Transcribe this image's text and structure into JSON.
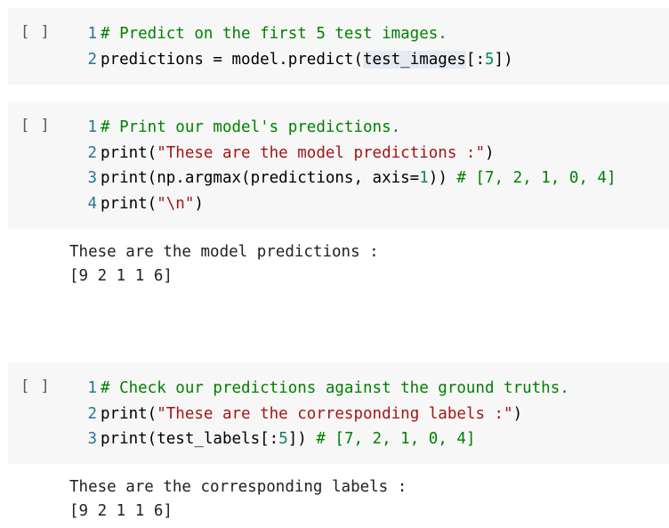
{
  "cells": [
    {
      "run_label": "[ ]",
      "lines": [
        {
          "num": "1",
          "tokens": [
            {
              "t": "# Predict on the first 5 test images.",
              "c": "c-com"
            }
          ]
        },
        {
          "num": "2",
          "tokens": [
            {
              "t": "predictions = model.predict(",
              "c": "c-txt"
            },
            {
              "t": "test_images",
              "c": "c-txt c-hl"
            },
            {
              "t": "[:",
              "c": "c-txt"
            },
            {
              "t": "5",
              "c": "c-num"
            },
            {
              "t": "])",
              "c": "c-txt"
            }
          ]
        }
      ],
      "output": []
    },
    {
      "run_label": "[ ]",
      "lines": [
        {
          "num": "1",
          "tokens": [
            {
              "t": "# Print our model's predictions.",
              "c": "c-com"
            }
          ]
        },
        {
          "num": "2",
          "tokens": [
            {
              "t": "print(",
              "c": "c-txt"
            },
            {
              "t": "\"These are the model predictions :\"",
              "c": "c-str"
            },
            {
              "t": ")",
              "c": "c-txt"
            }
          ]
        },
        {
          "num": "3",
          "tokens": [
            {
              "t": "print(np.argmax(predictions, axis=",
              "c": "c-txt"
            },
            {
              "t": "1",
              "c": "c-num"
            },
            {
              "t": ")) ",
              "c": "c-txt"
            },
            {
              "t": "# [7, 2, 1, 0, 4]",
              "c": "c-com"
            }
          ]
        },
        {
          "num": "4",
          "tokens": [
            {
              "t": "print(",
              "c": "c-txt"
            },
            {
              "t": "\"\\n\"",
              "c": "c-str"
            },
            {
              "t": ")",
              "c": "c-txt"
            }
          ]
        }
      ],
      "output": [
        "These are the model predictions :",
        "[9 2 1 1 6]"
      ]
    },
    {
      "run_label": "[ ]",
      "lines": [
        {
          "num": "1",
          "tokens": [
            {
              "t": "# Check our predictions against the ground truths.",
              "c": "c-com"
            }
          ]
        },
        {
          "num": "2",
          "tokens": [
            {
              "t": "print(",
              "c": "c-txt"
            },
            {
              "t": "\"These are the corresponding labels :\"",
              "c": "c-str"
            },
            {
              "t": ")",
              "c": "c-txt"
            }
          ]
        },
        {
          "num": "3",
          "tokens": [
            {
              "t": "print(test_labels[:",
              "c": "c-txt"
            },
            {
              "t": "5",
              "c": "c-num"
            },
            {
              "t": "]) ",
              "c": "c-txt"
            },
            {
              "t": "# [7, 2, 1, 0, 4]",
              "c": "c-com"
            }
          ]
        }
      ],
      "output": [
        "These are the corresponding labels :",
        "[9 2 1 1 6]"
      ]
    }
  ]
}
